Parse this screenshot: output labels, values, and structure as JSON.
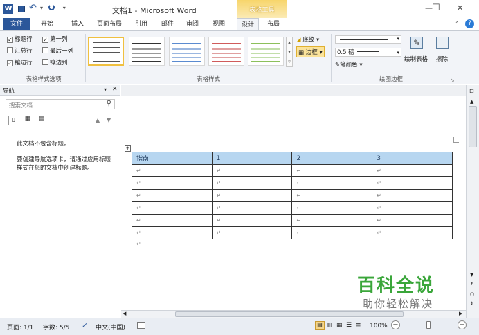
{
  "window": {
    "title": "文档1 - Microsoft Word",
    "context_tab_group": "表格工具",
    "controls": {
      "minimize": "—",
      "maximize": "☐",
      "close": "✕"
    }
  },
  "quick_access": {
    "app_icon": "W",
    "undo_glyph": "↶",
    "dropdown_glyph": "▾"
  },
  "tabs": [
    "文件",
    "开始",
    "插入",
    "页面布局",
    "引用",
    "邮件",
    "审阅",
    "视图",
    "设计",
    "布局"
  ],
  "active_tab": "设计",
  "ribbon": {
    "options_group": {
      "label": "表格样式选项",
      "items": [
        {
          "label": "标题行",
          "checked": true
        },
        {
          "label": "第一列",
          "checked": true
        },
        {
          "label": "汇总行",
          "checked": false
        },
        {
          "label": "最后一列",
          "checked": false
        },
        {
          "label": "镶边行",
          "checked": true
        },
        {
          "label": "镶边列",
          "checked": false
        }
      ]
    },
    "styles_group": {
      "label": "表格样式",
      "shading": "底纹",
      "borders": "边框"
    },
    "borders_group": {
      "label": "绘图边框",
      "pen_weight": "0.5 磅",
      "pen_color": "笔颜色",
      "draw_table": "绘制表格",
      "eraser": "擦除"
    }
  },
  "nav_pane": {
    "title": "导航",
    "search_placeholder": "搜索文档",
    "no_headings": "此文档不包含标题。",
    "hint": "要创建导航选项卡，请通过应用标题样式在您的文档中创建标题。"
  },
  "table": {
    "headers": [
      "指南",
      "1",
      "2",
      "3"
    ],
    "rows": 6,
    "cell_mark": "↵"
  },
  "status": {
    "page": "页面: 1/1",
    "words": "字数: 5/5",
    "language": "中文(中国)",
    "zoom": "100%"
  },
  "watermark": {
    "line1": "百科全说",
    "line2": "助你轻松解决"
  },
  "colors": {
    "accent": "#2b579a",
    "context_tab": "#f5c84a",
    "header_row": "#b7d6f0",
    "watermark": "#3aa63a"
  }
}
